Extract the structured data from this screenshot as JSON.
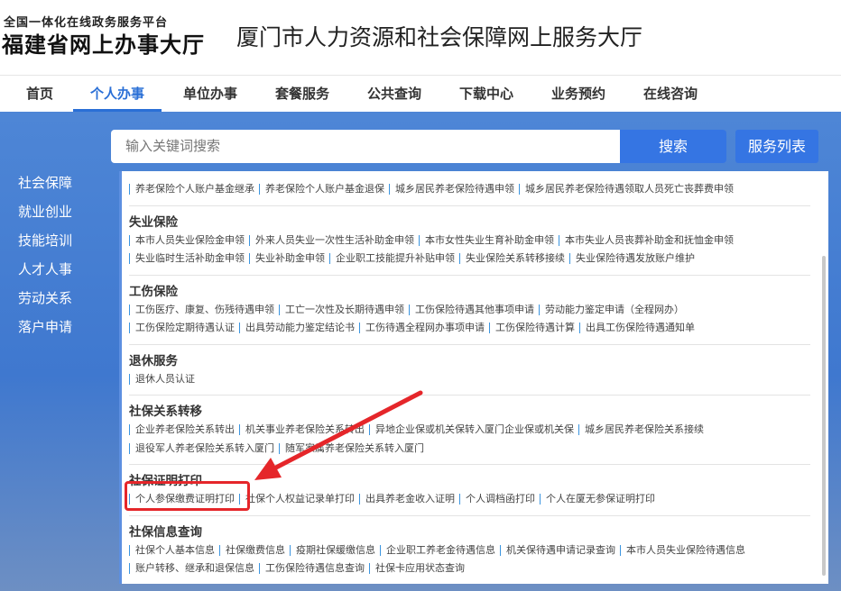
{
  "header": {
    "logo_top": "全国一体化在线政务服务平台",
    "logo_main": "福建省网上办事大厅",
    "site_title": "厦门市人力资源和社会保障网上服务大厅"
  },
  "nav": [
    "首页",
    "个人办事",
    "单位办事",
    "套餐服务",
    "公共查询",
    "下载中心",
    "业务预约",
    "在线咨询"
  ],
  "search": {
    "placeholder": "输入关键词搜索",
    "search_label": "搜索",
    "list_label": "服务列表"
  },
  "sidebar": [
    "社会保障",
    "就业创业",
    "技能培训",
    "人才人事",
    "劳动关系",
    "落户申请"
  ],
  "colors": {
    "accent": "#3575e3",
    "highlight": "#e5262a"
  },
  "sections": [
    {
      "title": "",
      "rows": [
        [
          "养老保险个人账户基金继承",
          "养老保险个人账户基金退保",
          "城乡居民养老保险待遇申领",
          "城乡居民养老保险待遇领取人员死亡丧葬费申领"
        ]
      ]
    },
    {
      "title": "失业保险",
      "rows": [
        [
          "本市人员失业保险金申领",
          "外来人员失业一次性生活补助金申领",
          "本市女性失业生育补助金申领",
          "本市失业人员丧葬补助金和抚恤金申领"
        ],
        [
          "失业临时生活补助金申领",
          "失业补助金申领",
          "企业职工技能提升补贴申领",
          "失业保险关系转移接续",
          "失业保险待遇发放账户维护"
        ]
      ]
    },
    {
      "title": "工伤保险",
      "rows": [
        [
          "工伤医疗、康复、伤残待遇申领",
          "工亡一次性及长期待遇申领",
          "工伤保险待遇其他事项申请",
          "劳动能力鉴定申请（全程网办）"
        ],
        [
          "工伤保险定期待遇认证",
          "出具劳动能力鉴定结论书",
          "工伤待遇全程网办事项申请",
          "工伤保险待遇计算",
          "出具工伤保险待遇通知单"
        ]
      ]
    },
    {
      "title": "退休服务",
      "rows": [
        [
          "退休人员认证"
        ]
      ]
    },
    {
      "title": "社保关系转移",
      "rows": [
        [
          "企业养老保险关系转出",
          "机关事业养老保险关系转出",
          "异地企业保或机关保转入厦门企业保或机关保",
          "城乡居民养老保险关系接续"
        ],
        [
          "退役军人养老保险关系转入厦门",
          "随军家属养老保险关系转入厦门"
        ]
      ]
    },
    {
      "title": "社保证明打印",
      "rows": [
        [
          "个人参保缴费证明打印",
          "社保个人权益记录单打印",
          "出具养老金收入证明",
          "个人调档函打印",
          "个人在厦无参保证明打印"
        ]
      ]
    },
    {
      "title": "社保信息查询",
      "rows": [
        [
          "社保个人基本信息",
          "社保缴费信息",
          "疫期社保缓缴信息",
          "企业职工养老金待遇信息",
          "机关保待遇申请记录查询",
          "本市人员失业保险待遇信息"
        ],
        [
          "账户转移、继承和退保信息",
          "工伤保险待遇信息查询",
          "社保卡应用状态查询"
        ]
      ]
    }
  ]
}
